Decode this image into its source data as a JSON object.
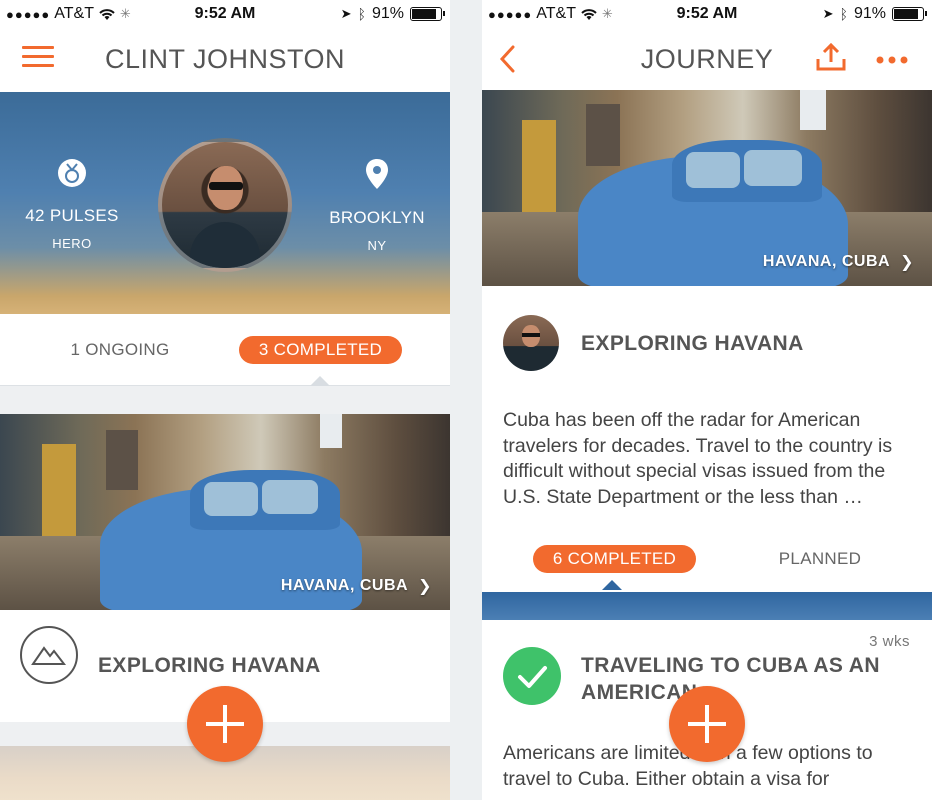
{
  "status_bar": {
    "carrier": "AT&T",
    "time": "9:52 AM",
    "battery": "91%"
  },
  "left": {
    "title": "CLINT JOHNSTON",
    "stats": {
      "pulses": "42 PULSES",
      "rank": "HERO",
      "city": "BROOKLYN",
      "state": "NY"
    },
    "tabs": {
      "ongoing": "1 ONGOING",
      "completed": "3 COMPLETED"
    },
    "photo_caption": "HAVANA, CUBA",
    "card_title": "EXPLORING HAVANA"
  },
  "right": {
    "title": "JOURNEY",
    "photo_caption": "HAVANA, CUBA",
    "journey_title": "EXPLORING HAVANA",
    "description": "Cuba has been off the radar for American travelers for decades. Travel to the country is difficult without special visas issued from the U.S. State Department or the less than …",
    "tabs": {
      "completed": "6 COMPLETED",
      "planned": "PLANNED"
    },
    "entry": {
      "age": "3 wks",
      "title": "TRAVELING TO CUBA AS AN AMERICAN",
      "body": "Americans are limited with a few options to travel to Cuba. Either obtain a visa for"
    }
  },
  "colors": {
    "accent": "#f26a2e",
    "success": "#3fc26a"
  }
}
